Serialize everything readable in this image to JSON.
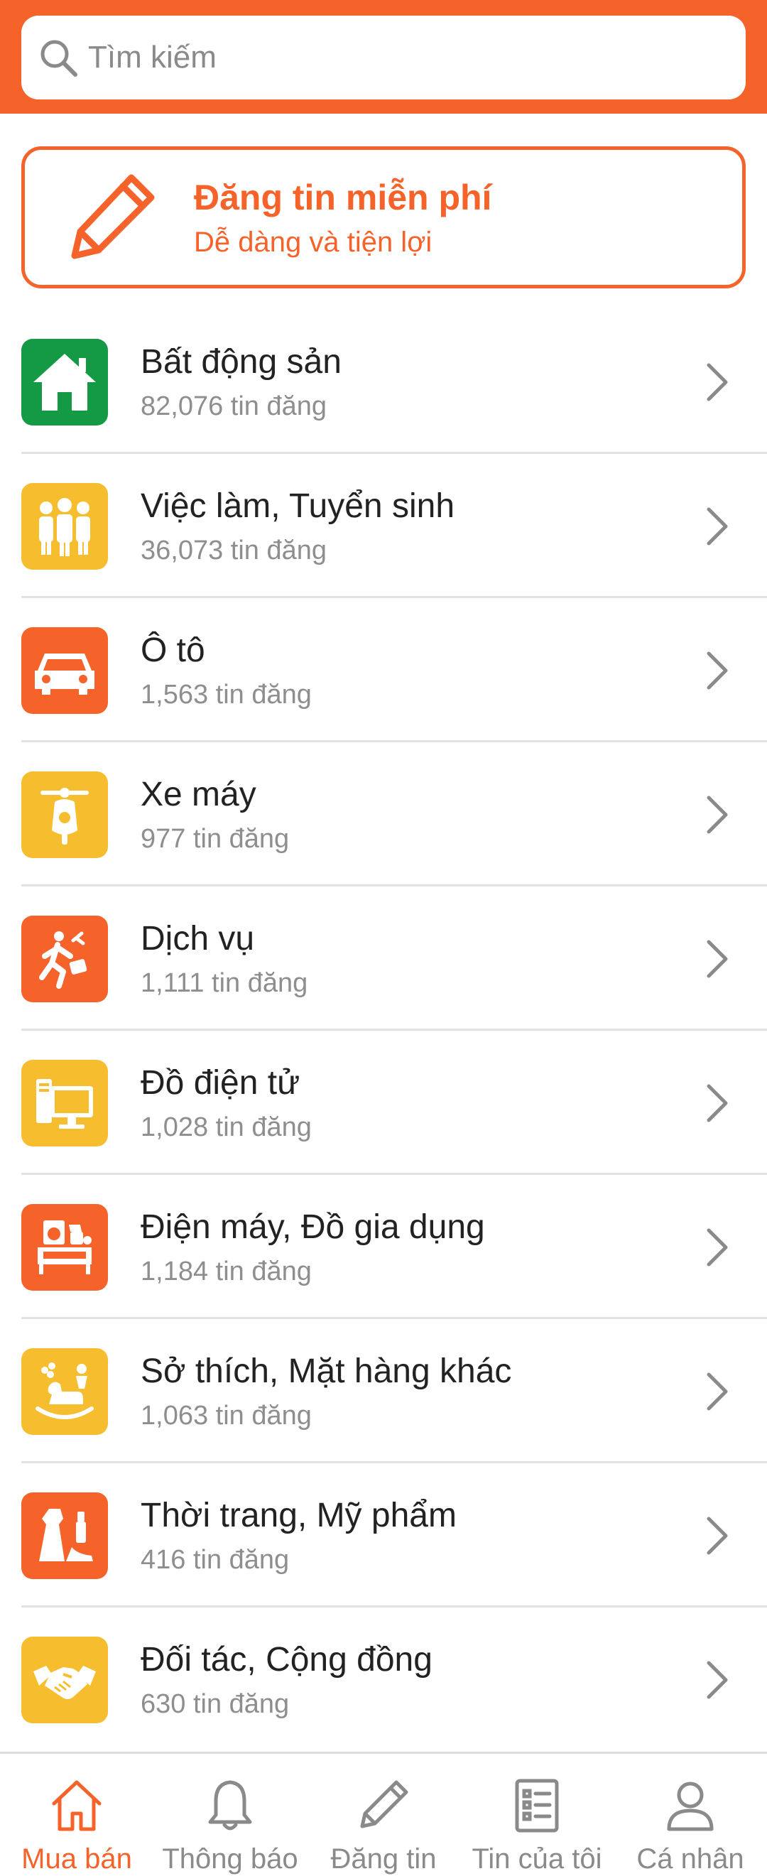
{
  "search": {
    "placeholder": "Tìm kiếm"
  },
  "post_banner": {
    "title": "Đăng tin miễn phí",
    "subtitle": "Dễ dàng và tiện lợi"
  },
  "categories": [
    {
      "name": "Bất động sản",
      "count": "82,076 tin đăng",
      "icon": "house-icon",
      "color": "#149A45"
    },
    {
      "name": "Việc làm, Tuyển sinh",
      "count": "36,073 tin đăng",
      "icon": "people-icon",
      "color": "#F6BE2F"
    },
    {
      "name": "Ô tô",
      "count": "1,563 tin đăng",
      "icon": "car-icon",
      "color": "#F5632A"
    },
    {
      "name": "Xe máy",
      "count": "977 tin đăng",
      "icon": "scooter-icon",
      "color": "#F6BE2F"
    },
    {
      "name": "Dịch vụ",
      "count": "1,111 tin đăng",
      "icon": "running-man-icon",
      "color": "#F5632A"
    },
    {
      "name": "Đồ điện tử",
      "count": "1,028 tin đăng",
      "icon": "computer-icon",
      "color": "#F6BE2F"
    },
    {
      "name": "Điện máy, Đồ gia dụng",
      "count": "1,184 tin đăng",
      "icon": "appliances-icon",
      "color": "#F5632A"
    },
    {
      "name": "Sở thích, Mặt hàng khác",
      "count": "1,063 tin đăng",
      "icon": "rocking-horse-icon",
      "color": "#F6BE2F"
    },
    {
      "name": "Thời trang, Mỹ phẩm",
      "count": "416 tin đăng",
      "icon": "fashion-icon",
      "color": "#F5632A"
    },
    {
      "name": "Đối tác, Cộng đồng",
      "count": "630 tin đăng",
      "icon": "handshake-icon",
      "color": "#F6BE2F"
    }
  ],
  "bottom_nav": [
    {
      "label": "Mua bán",
      "icon": "home-icon",
      "active": true
    },
    {
      "label": "Thông báo",
      "icon": "bell-icon",
      "active": false
    },
    {
      "label": "Đăng tin",
      "icon": "pencil-icon",
      "active": false
    },
    {
      "label": "Tin của tôi",
      "icon": "list-icon",
      "active": false
    },
    {
      "label": "Cá nhân",
      "icon": "user-icon",
      "active": false
    }
  ],
  "colors": {
    "accent": "#F5632A",
    "green": "#149A45",
    "yellow": "#F6BE2F"
  }
}
